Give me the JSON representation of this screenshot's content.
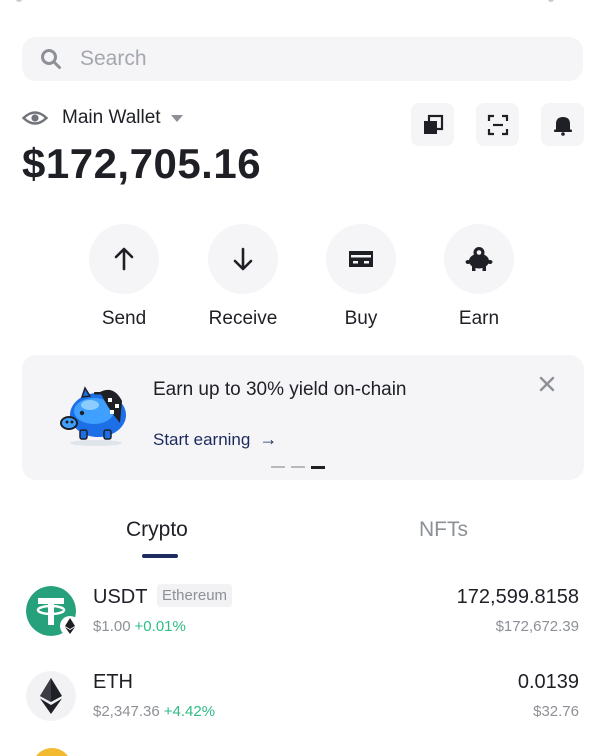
{
  "search": {
    "placeholder": "Search"
  },
  "wallet": {
    "name": "Main Wallet",
    "balance": "$172,705.16"
  },
  "top_icons": [
    "copy-icon",
    "scan-icon",
    "bell-icon"
  ],
  "actions": [
    {
      "label": "Send",
      "icon": "arrow-up-icon"
    },
    {
      "label": "Receive",
      "icon": "arrow-down-icon"
    },
    {
      "label": "Buy",
      "icon": "card-icon"
    },
    {
      "label": "Earn",
      "icon": "piggy-bank-icon"
    }
  ],
  "promo": {
    "title": "Earn up to 30% yield on-chain",
    "link": "Start earning",
    "link_arrow": "→",
    "active_slide": 3,
    "slide_count": 3
  },
  "tabs": [
    {
      "label": "Crypto",
      "active": true
    },
    {
      "label": "NFTs",
      "active": false
    }
  ],
  "assets": [
    {
      "symbol": "USDT",
      "network": "Ethereum",
      "price": "$1.00",
      "change": "+0.01%",
      "amount": "172,599.8158",
      "value": "$172,672.39"
    },
    {
      "symbol": "ETH",
      "network": "",
      "price": "$2,347.36",
      "change": "+4.42%",
      "amount": "0.0139",
      "value": "$32.76"
    }
  ],
  "colors": {
    "accent": "#1c2a5e",
    "positive": "#2ebd85",
    "tether": "#26a17b",
    "muted": "#8d9096",
    "surface": "#f5f5f7"
  }
}
